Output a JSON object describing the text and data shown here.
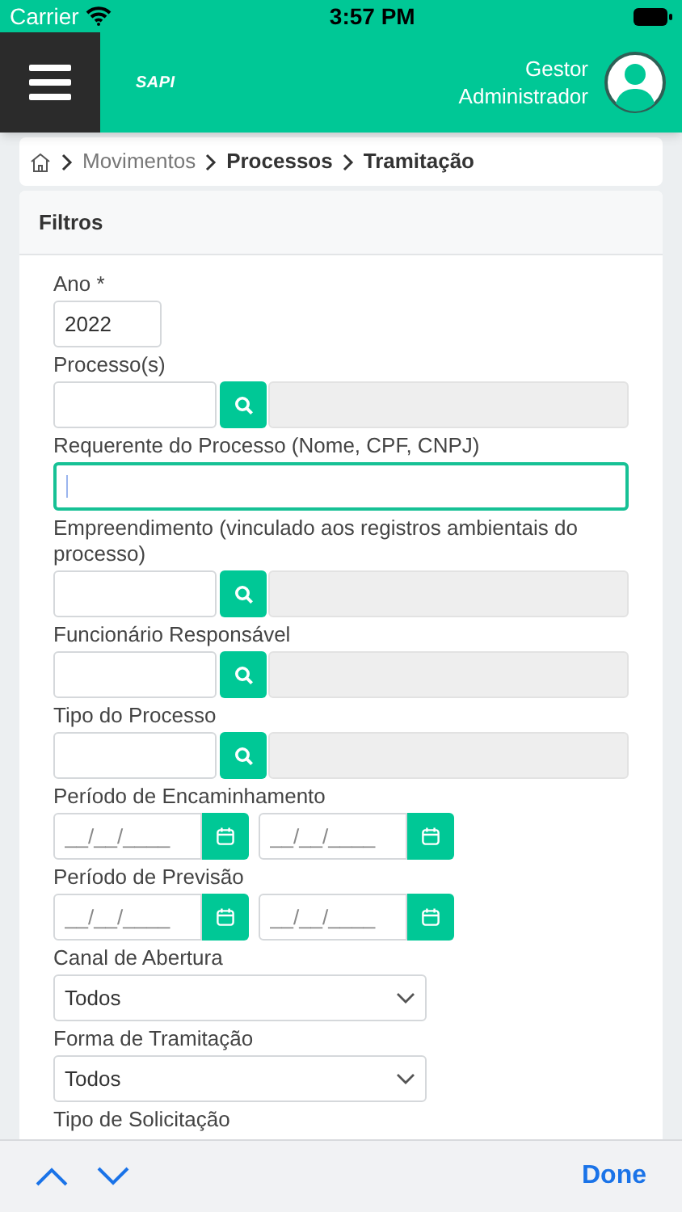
{
  "status_bar": {
    "carrier": "Carrier",
    "time": "3:57 PM"
  },
  "header": {
    "logo": "SAPI",
    "user": "Gestor Administrador"
  },
  "breadcrumb": [
    {
      "label": "Movimentos",
      "current": false
    },
    {
      "label": "Processos",
      "current": true
    },
    {
      "label": "Tramitação",
      "current": true
    }
  ],
  "filters": {
    "title": "Filtros",
    "fields": [
      {
        "kind": "text",
        "label": "Ano *",
        "value": "2022"
      },
      {
        "kind": "lookup",
        "label": "Processo(s)"
      },
      {
        "kind": "input",
        "label": "Requerente do Processo (Nome, CPF, CNPJ)",
        "focused": true
      },
      {
        "kind": "lookup",
        "label": "Empreendimento (vinculado aos registros ambientais do processo)"
      },
      {
        "kind": "lookup",
        "label": "Funcionário Responsável"
      },
      {
        "kind": "lookup",
        "label": "Tipo do Processo"
      },
      {
        "kind": "date_range",
        "label": "Período de Encaminhamento",
        "placeholders": [
          "__/__/____",
          "__/__/____"
        ]
      },
      {
        "kind": "date_range",
        "label": "Período de Previsão",
        "placeholders": [
          "__/__/____",
          "__/__/____"
        ]
      },
      {
        "kind": "select",
        "label": "Canal de Abertura",
        "value": "Todos"
      },
      {
        "kind": "select",
        "label": "Forma de Tramitação",
        "value": "Todos"
      },
      {
        "kind": "label",
        "label": "Tipo de Solicitação"
      }
    ]
  },
  "keyboard_toolbar": {
    "done": "Done"
  }
}
